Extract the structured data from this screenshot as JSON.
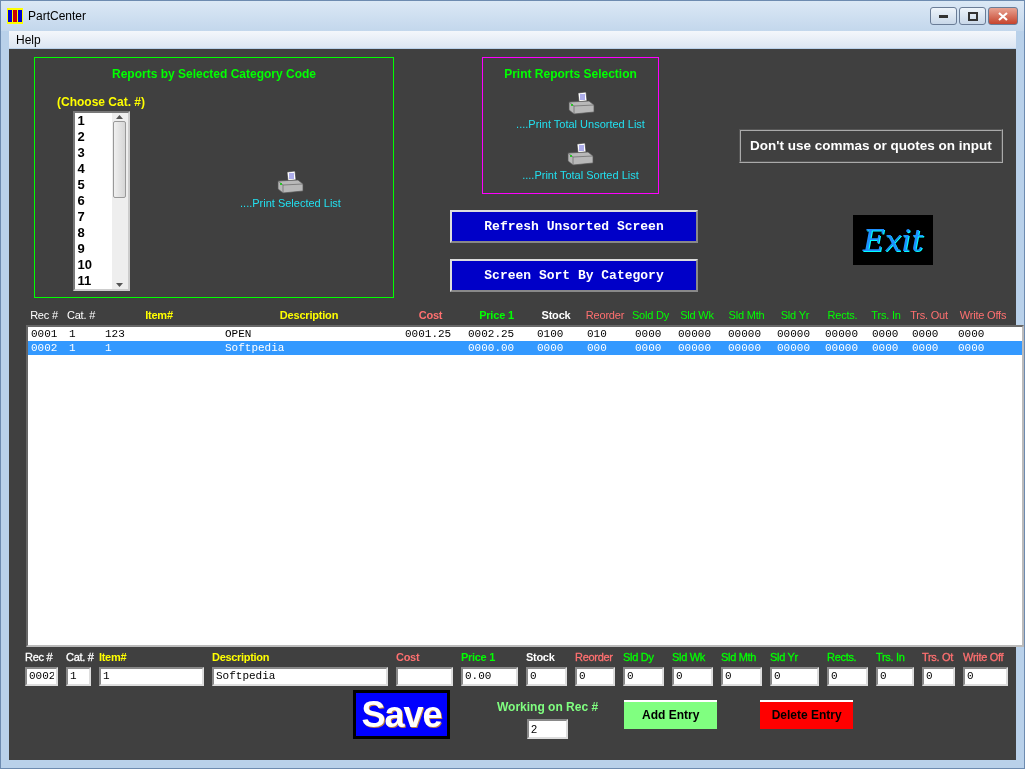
{
  "window": {
    "title": "PartCenter"
  },
  "menu": [
    "Help"
  ],
  "category_reports": {
    "title": "Reports by Selected Category Code",
    "list_label": "(Choose Cat. #)",
    "categories": [
      "1",
      "2",
      "3",
      "4",
      "5",
      "6",
      "7",
      "8",
      "9",
      "10",
      "11"
    ],
    "print_link": "....Print Selected List"
  },
  "print_reports": {
    "title": "Print Reports Selection",
    "links": [
      "....Print Total Unsorted List",
      "....Print Total Sorted List"
    ]
  },
  "buttons": [
    {
      "label": "Refresh Unsorted Screen"
    },
    {
      "label": "Screen Sort By Category"
    }
  ],
  "notice": "Don't use commas or quotes on input",
  "exit_button": "Exit",
  "table": {
    "columns": [
      {
        "label": "Rec #",
        "color": "#ffffff",
        "bold": false
      },
      {
        "label": "Cat. #",
        "color": "#ffffff",
        "bold": false
      },
      {
        "label": "Item#",
        "color": "#ffff00",
        "bold": true
      },
      {
        "label": "Description",
        "color": "#ffff00",
        "bold": true
      },
      {
        "label": "Cost",
        "color": "#ff7070",
        "bold": true
      },
      {
        "label": "Price 1",
        "color": "#00ff00",
        "bold": true
      },
      {
        "label": "Stock",
        "color": "#ffffff",
        "bold": true
      },
      {
        "label": "Reorder",
        "color": "#ff7070",
        "bold": false
      },
      {
        "label": "Sold Dy",
        "color": "#00ff00",
        "bold": false
      },
      {
        "label": "Sld Wk",
        "color": "#00ff00",
        "bold": false
      },
      {
        "label": "Sld Mth",
        "color": "#00ff00",
        "bold": false
      },
      {
        "label": "Sld Yr",
        "color": "#00ff00",
        "bold": false
      },
      {
        "label": "Rects.",
        "color": "#00ff00",
        "bold": false
      },
      {
        "label": "Trs. In",
        "color": "#00ff00",
        "bold": false
      },
      {
        "label": "Trs. Out",
        "color": "#ff7070",
        "bold": false
      },
      {
        "label": "Write Offs",
        "color": "#ff7070",
        "bold": false
      }
    ],
    "rows": [
      {
        "selected": false,
        "cells": [
          "0001",
          "1",
          "123",
          "OPEN",
          "0001.25",
          "0002.25",
          "0100",
          "010",
          "0000",
          "00000",
          "00000",
          "00000",
          "00000",
          "0000",
          "0000",
          "0000"
        ]
      },
      {
        "selected": true,
        "cells": [
          "0002",
          "1",
          "1",
          "Softpedia",
          "",
          "0000.00",
          "0000",
          "000",
          "0000",
          "00000",
          "00000",
          "00000",
          "00000",
          "0000",
          "0000",
          "0000"
        ]
      }
    ]
  },
  "entry": {
    "fields": [
      {
        "label": "Rec #",
        "color": "#ffffff",
        "bold": false,
        "value": "0002"
      },
      {
        "label": "Cat. #",
        "color": "#ffffff",
        "bold": false,
        "value": "1"
      },
      {
        "label": "Item#",
        "color": "#ffff00",
        "bold": true,
        "value": "1"
      },
      {
        "label": "Description",
        "color": "#ffff00",
        "bold": true,
        "value": "Softpedia"
      },
      {
        "label": "Cost",
        "color": "#ff7070",
        "bold": true
      },
      {
        "label": "Price 1",
        "color": "#00ff00",
        "bold": true,
        "value": "0.00"
      },
      {
        "label": "Stock",
        "color": "#ffffff",
        "bold": true,
        "value": "0"
      },
      {
        "label": "Reorder",
        "color": "#ff7070",
        "bold": false,
        "value": "0"
      },
      {
        "label": "Sld Dy",
        "color": "#00ff00",
        "bold": false,
        "value": "0"
      },
      {
        "label": "Sld Wk",
        "color": "#00ff00",
        "bold": false,
        "value": "0"
      },
      {
        "label": "Sld Mth",
        "color": "#00ff00",
        "bold": false,
        "value": "0"
      },
      {
        "label": "Sld Yr",
        "color": "#00ff00",
        "bold": false,
        "value": "0"
      },
      {
        "label": "Rects.",
        "color": "#00ff00",
        "bold": false,
        "value": "0"
      },
      {
        "label": "Trs. In",
        "color": "#00ff00",
        "bold": false,
        "value": "0"
      },
      {
        "label": "Trs. Ot",
        "color": "#ff7070",
        "bold": false,
        "value": "0"
      },
      {
        "label": "Write Off",
        "color": "#ff7070",
        "bold": false,
        "value": "0"
      }
    ],
    "save_button": "Save",
    "working_label": "Working on Rec #",
    "working_value": "2",
    "add_button": "Add Entry",
    "delete_button": "Delete Entry"
  }
}
